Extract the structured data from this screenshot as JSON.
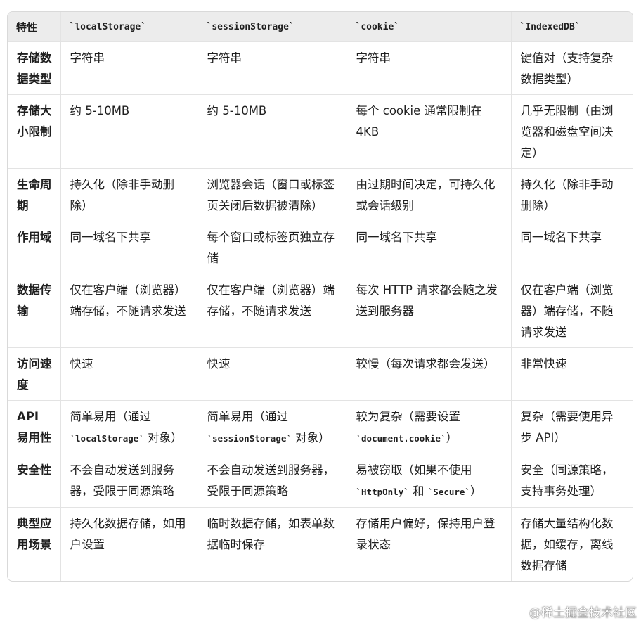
{
  "header": [
    "特性",
    "`localStorage`",
    "`sessionStorage`",
    "`cookie`",
    "`IndexedDB`"
  ],
  "rows": [
    {
      "feature": "存储数据类型",
      "cells": [
        [
          "字符串"
        ],
        [
          "字符串"
        ],
        [
          "字符串"
        ],
        [
          "键值对（支持复杂数据类型）"
        ]
      ]
    },
    {
      "feature": "存储大小限制",
      "cells": [
        [
          "约 5-10MB"
        ],
        [
          "约 5-10MB"
        ],
        [
          "每个 cookie 通常限制在 4KB"
        ],
        [
          "几乎无限制（由浏览器和磁盘空间决定）"
        ]
      ]
    },
    {
      "feature": "生命周期",
      "cells": [
        [
          "持久化（除非手动删除）"
        ],
        [
          "浏览器会话（窗口或标签页关闭后数据被清除）"
        ],
        [
          "由过期时间决定，可持久化或会话级别"
        ],
        [
          "持久化（除非手动删除）"
        ]
      ]
    },
    {
      "feature": "作用域",
      "cells": [
        [
          "同一域名下共享"
        ],
        [
          "每个窗口或标签页独立存储"
        ],
        [
          "同一域名下共享"
        ],
        [
          "同一域名下共享"
        ]
      ]
    },
    {
      "feature": "数据传输",
      "cells": [
        [
          "仅在客户端（浏览器）端存储，不随请求发送"
        ],
        [
          "仅在客户端（浏览器）端存储，不随请求发送"
        ],
        [
          "每次 HTTP 请求都会随之发送到服务器"
        ],
        [
          "仅在客户端（浏览器）端存储，不随请求发送"
        ]
      ]
    },
    {
      "feature": "访问速度",
      "cells": [
        [
          "快速"
        ],
        [
          "快速"
        ],
        [
          "较慢（每次请求都会发送）"
        ],
        [
          "非常快速"
        ]
      ]
    },
    {
      "feature": "API 易用性",
      "cells": [
        [
          "简单易用（通过 ",
          "`localStorage`",
          " 对象）"
        ],
        [
          "简单易用（通过 ",
          "`sessionStorage`",
          " 对象）"
        ],
        [
          "较为复杂（需要设置 ",
          "`document.cookie`",
          "）"
        ],
        [
          "复杂（需要使用异步 API）"
        ]
      ]
    },
    {
      "feature": "安全性",
      "cells": [
        [
          "不会自动发送到服务器，受限于同源策略"
        ],
        [
          "不会自动发送到服务器，受限于同源策略"
        ],
        [
          "易被窃取（如果不使用 ",
          "`HttpOnly`",
          " 和 ",
          "`Secure`",
          "）"
        ],
        [
          "安全（同源策略，支持事务处理）"
        ]
      ]
    },
    {
      "feature": "典型应用场景",
      "cells": [
        [
          "持久化数据存储，如用户设置"
        ],
        [
          "临时数据存储，如表单数据临时保存"
        ],
        [
          "存储用户偏好，保持用户登录状态"
        ],
        [
          "存储大量结构化数据，如缓存，离线数据存储"
        ]
      ]
    }
  ],
  "watermark": "@稀土掘金技术社区"
}
